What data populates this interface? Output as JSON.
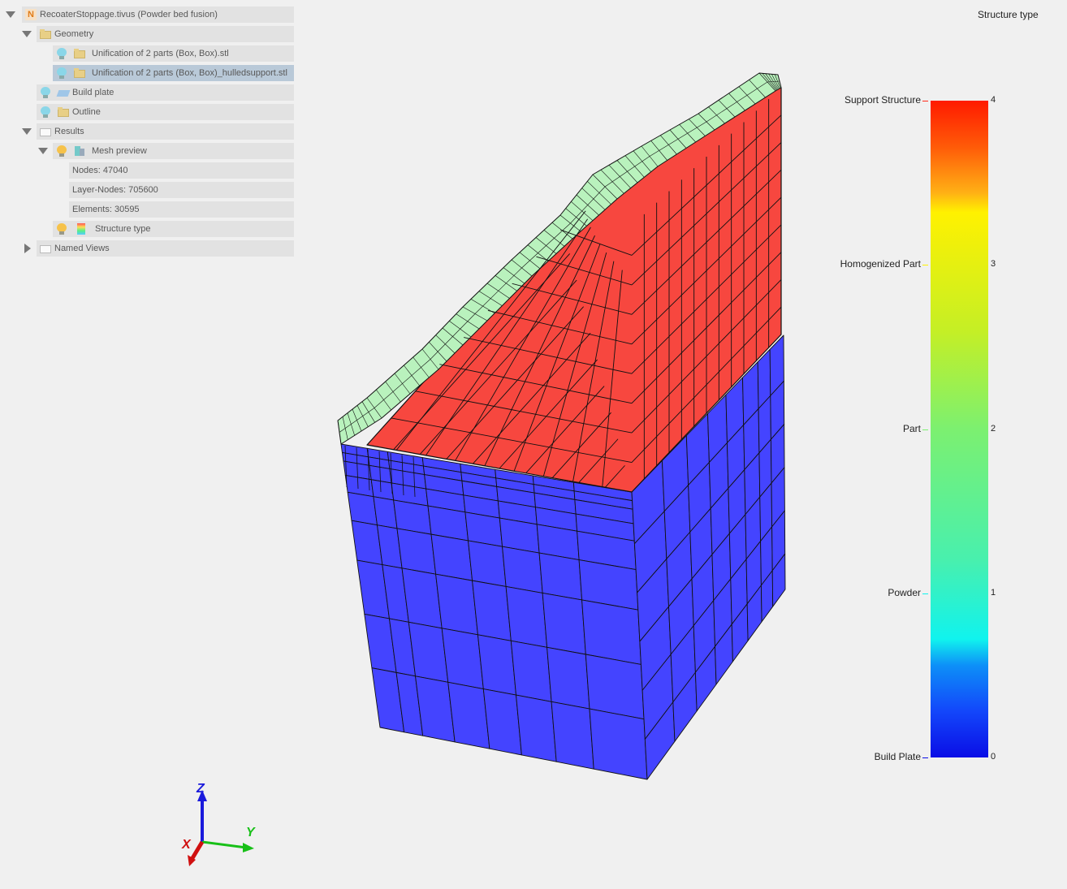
{
  "tree": {
    "root_label": "RecoaterStoppage.tivus (Powder bed fusion)",
    "geometry_label": "Geometry",
    "geom_item1_label": "Unification of 2 parts (Box, Box).stl",
    "geom_item2_label": "Unification of 2 parts (Box, Box)_hulledsupport.stl",
    "build_plate_label": "Build plate",
    "outline_label": "Outline",
    "results_label": "Results",
    "mesh_preview_label": "Mesh preview",
    "nodes_label": "Nodes: 47040",
    "layer_nodes_label": "Layer-Nodes: 705600",
    "elements_label": "Elements: 30595",
    "structure_type_label": "Structure type",
    "named_views_label": "Named Views"
  },
  "legend": {
    "title": "Structure type",
    "categories": [
      {
        "label": "Support Structure",
        "value": "4",
        "color": "#ff2a1a"
      },
      {
        "label": "Homogenized Part",
        "value": "3",
        "color": "#fff100"
      },
      {
        "label": "Part",
        "value": "2",
        "color": "#7cf070"
      },
      {
        "label": "Powder",
        "value": "1",
        "color": "#10f3ee"
      },
      {
        "label": "Build Plate",
        "value": "0",
        "color": "#0a0ee6"
      }
    ]
  },
  "viewport": {
    "colors": {
      "build_plate": "#4444ff",
      "support": "#f7473f",
      "part": "#b9f2bd",
      "edge": "#111111"
    }
  },
  "axes": {
    "x_label": "X",
    "y_label": "Y",
    "z_label": "Z",
    "x_color": "#d01010",
    "y_color": "#18c018",
    "z_color": "#1a1adc"
  }
}
